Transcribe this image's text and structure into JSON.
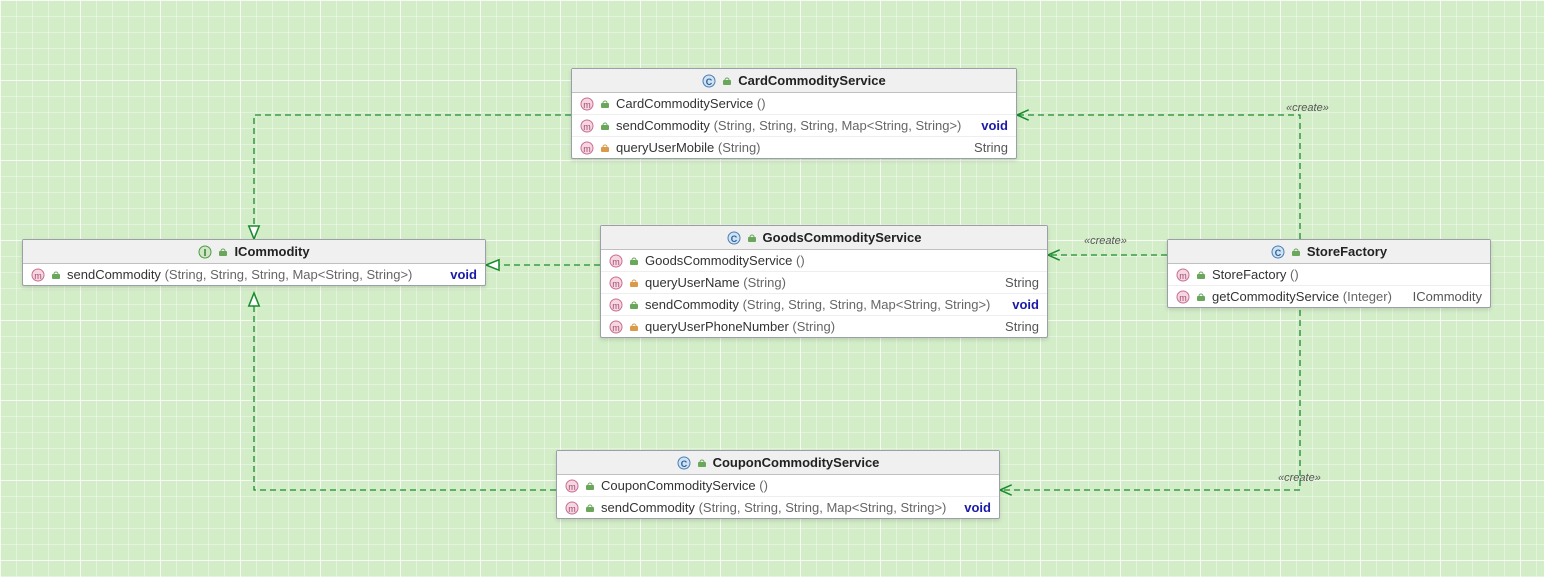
{
  "interface": {
    "name": "ICommodity",
    "method": {
      "name": "sendCommodity",
      "params": "(String, String, String, Map<String, String>)",
      "ret": "void"
    }
  },
  "card": {
    "name": "CardCommodityService",
    "ctor": "CardCommodityService",
    "ctor_p": "()",
    "m1": {
      "name": "sendCommodity",
      "params": "(String, String, String, Map<String, String>)",
      "ret": "void"
    },
    "m2": {
      "name": "queryUserMobile",
      "params": "(String)",
      "ret": "String"
    }
  },
  "goods": {
    "name": "GoodsCommodityService",
    "ctor": "GoodsCommodityService",
    "ctor_p": "()",
    "m1": {
      "name": "queryUserName",
      "params": "(String)",
      "ret": "String"
    },
    "m2": {
      "name": "sendCommodity",
      "params": "(String, String, String, Map<String, String>)",
      "ret": "void"
    },
    "m3": {
      "name": "queryUserPhoneNumber",
      "params": "(String)",
      "ret": "String"
    }
  },
  "coupon": {
    "name": "CouponCommodityService",
    "ctor": "CouponCommodityService",
    "ctor_p": "()",
    "m1": {
      "name": "sendCommodity",
      "params": "(String, String, String, Map<String, String>)",
      "ret": "void"
    }
  },
  "store": {
    "name": "StoreFactory",
    "ctor": "StoreFactory",
    "ctor_p": "()",
    "m1": {
      "name": "getCommodityService",
      "params": "(Integer)",
      "ret": "ICommodity"
    }
  },
  "stereotypes": {
    "create1": "«create»",
    "create2": "«create»",
    "create3": "«create»"
  }
}
